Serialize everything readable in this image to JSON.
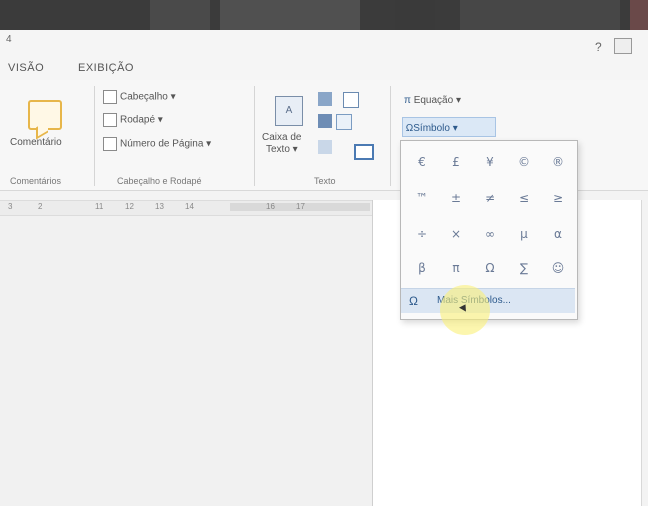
{
  "window": {
    "help_label": "?",
    "corner_text": "4"
  },
  "tabs": [
    {
      "label": "VISÃO"
    },
    {
      "label": "EXIBIÇÃO"
    }
  ],
  "ribbon": {
    "comment": {
      "label": "Comentário",
      "group_label": "Comentários"
    },
    "header_footer": {
      "header_label": "Cabeçalho",
      "footer_label": "Rodapé",
      "page_number_label": "Número de Página",
      "group_label": "Cabeçalho e Rodapé"
    },
    "text": {
      "textbox_label_line1": "Caixa de",
      "textbox_label_line2": "Texto",
      "group_label": "Texto"
    },
    "symbols": {
      "equation_label": "Equação",
      "symbol_label": "Símbolo"
    }
  },
  "ruler": {
    "ticks": [
      "3",
      "2",
      "11",
      "12",
      "13",
      "14",
      "16",
      "17"
    ]
  },
  "symbol_grid": [
    [
      "€",
      "£",
      "¥",
      "©",
      "®"
    ],
    [
      "™",
      "±",
      "≠",
      "≤",
      "≥"
    ],
    [
      "÷",
      "×",
      "∞",
      "µ",
      "α"
    ],
    [
      "β",
      "π",
      "Ω",
      "∑",
      "☺"
    ]
  ],
  "more_symbols": {
    "icon": "Ω",
    "label": "Mais Símbolos..."
  }
}
